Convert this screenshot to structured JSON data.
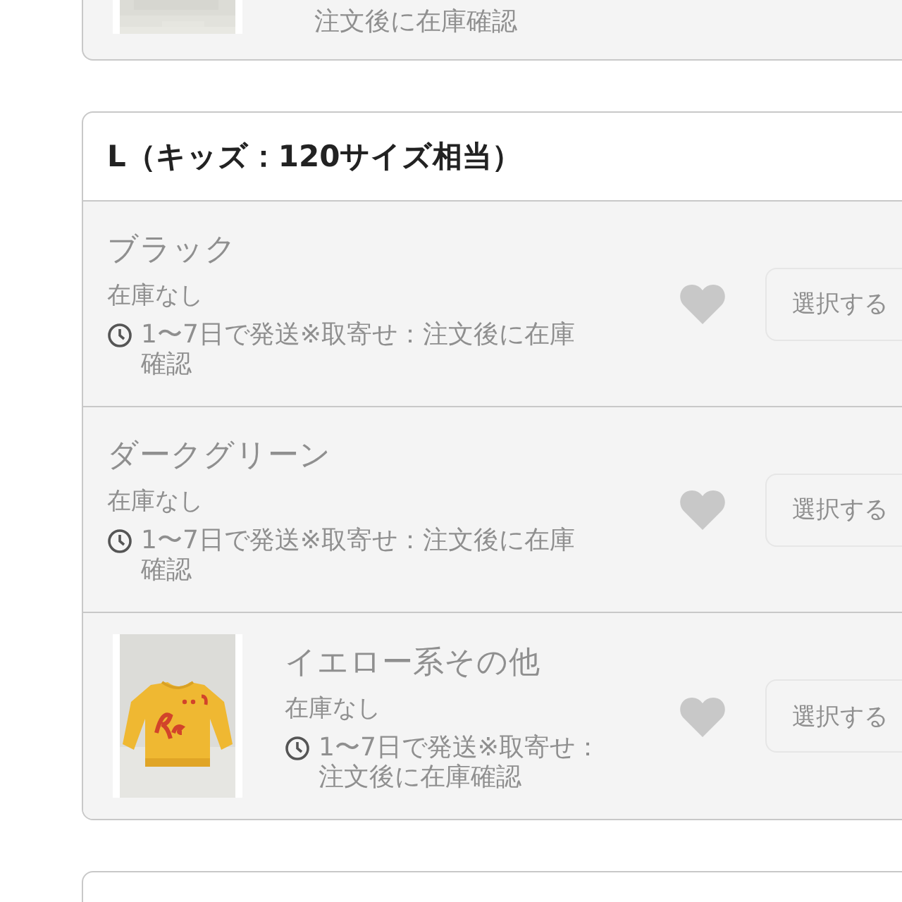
{
  "previous_card": {
    "delivery_tail": "注文後に在庫確認"
  },
  "size_group": {
    "title": "L（キッズ：120サイズ相当）",
    "variants": [
      {
        "name": "ブラック",
        "stock": "在庫なし",
        "delivery": "1〜7日で発送※取寄せ：注文後に在庫確認",
        "button": "選択する",
        "disabled": true
      },
      {
        "name": "ダークグリーン",
        "stock": "在庫なし",
        "delivery": "1〜7日で発送※取寄せ：注文後に在庫確認",
        "button": "選択する",
        "disabled": true
      },
      {
        "name": "イエロー系その他",
        "stock": "在庫なし",
        "delivery": "1〜7日で発送※取寄せ：注文後に在庫確認",
        "button": "選択する",
        "disabled": true
      }
    ]
  }
}
